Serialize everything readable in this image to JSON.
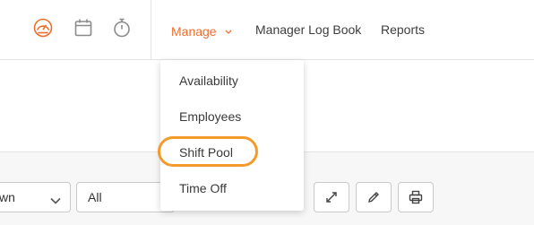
{
  "header": {
    "icons": [
      {
        "name": "dashboard-gauge-icon",
        "active": true,
        "color": "#f06c2d"
      },
      {
        "name": "calendar-icon",
        "active": false
      },
      {
        "name": "stopwatch-icon",
        "active": false
      }
    ],
    "nav": {
      "manage": "Manage",
      "manager_log_book": "Manager Log Book",
      "reports": "Reports"
    }
  },
  "manage_menu": {
    "items": [
      "Availability",
      "Employees",
      "Shift Pool",
      "Time Off"
    ],
    "highlighted": "Shift Pool"
  },
  "filters": {
    "select1_value": "wn",
    "select2_value": "All"
  },
  "toolbar": {
    "buttons": [
      "expand-icon",
      "pencil-icon",
      "printer-icon"
    ]
  },
  "colors": {
    "accent": "#f06c2d",
    "highlight_ring": "#f39a2b"
  }
}
